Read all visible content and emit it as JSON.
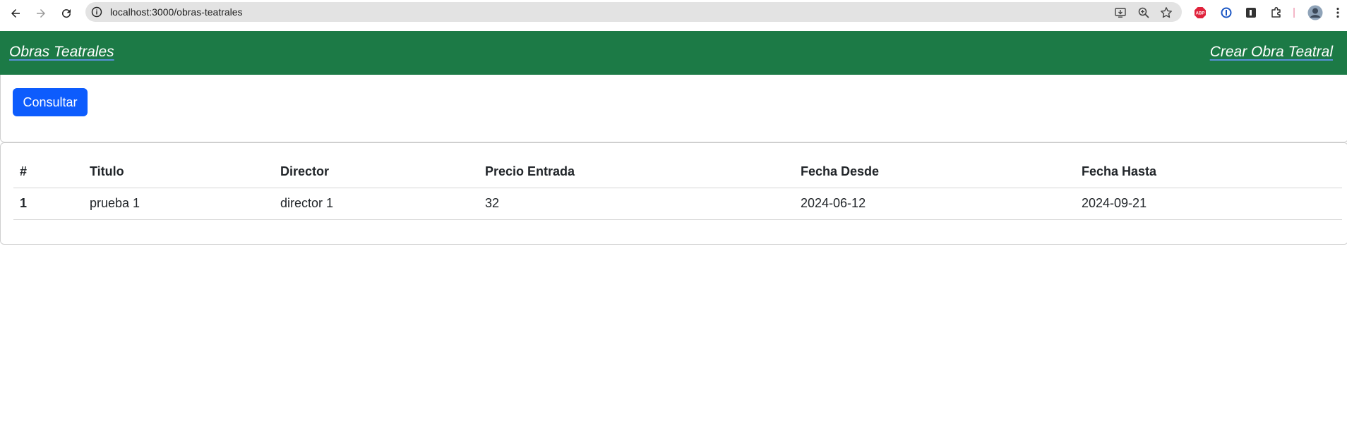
{
  "browser": {
    "url": "localhost:3000/obras-teatrales",
    "icons": [
      "back-icon",
      "forward-icon",
      "reload-icon",
      "site-info-icon",
      "install-app-icon",
      "zoom-icon",
      "bookmark-star-icon",
      "adblock-icon",
      "password-manager-icon",
      "reader-icon",
      "extensions-icon",
      "profile-avatar-icon",
      "menu-icon"
    ],
    "abp_label": "ABP"
  },
  "navbar": {
    "brand": "Obras Teatrales",
    "create_link": "Crear Obra Teatral",
    "color": "#1c7a46"
  },
  "actions": {
    "consult_label": "Consultar",
    "color": "#0d5cfd"
  },
  "table": {
    "headers": [
      "#",
      "Titulo",
      "Director",
      "Precio Entrada",
      "Fecha Desde",
      "Fecha Hasta"
    ],
    "rows": [
      {
        "id": "1",
        "titulo": "prueba 1",
        "director": "director 1",
        "precio": "32",
        "desde": "2024-06-12",
        "hasta": "2024-09-21"
      }
    ]
  }
}
